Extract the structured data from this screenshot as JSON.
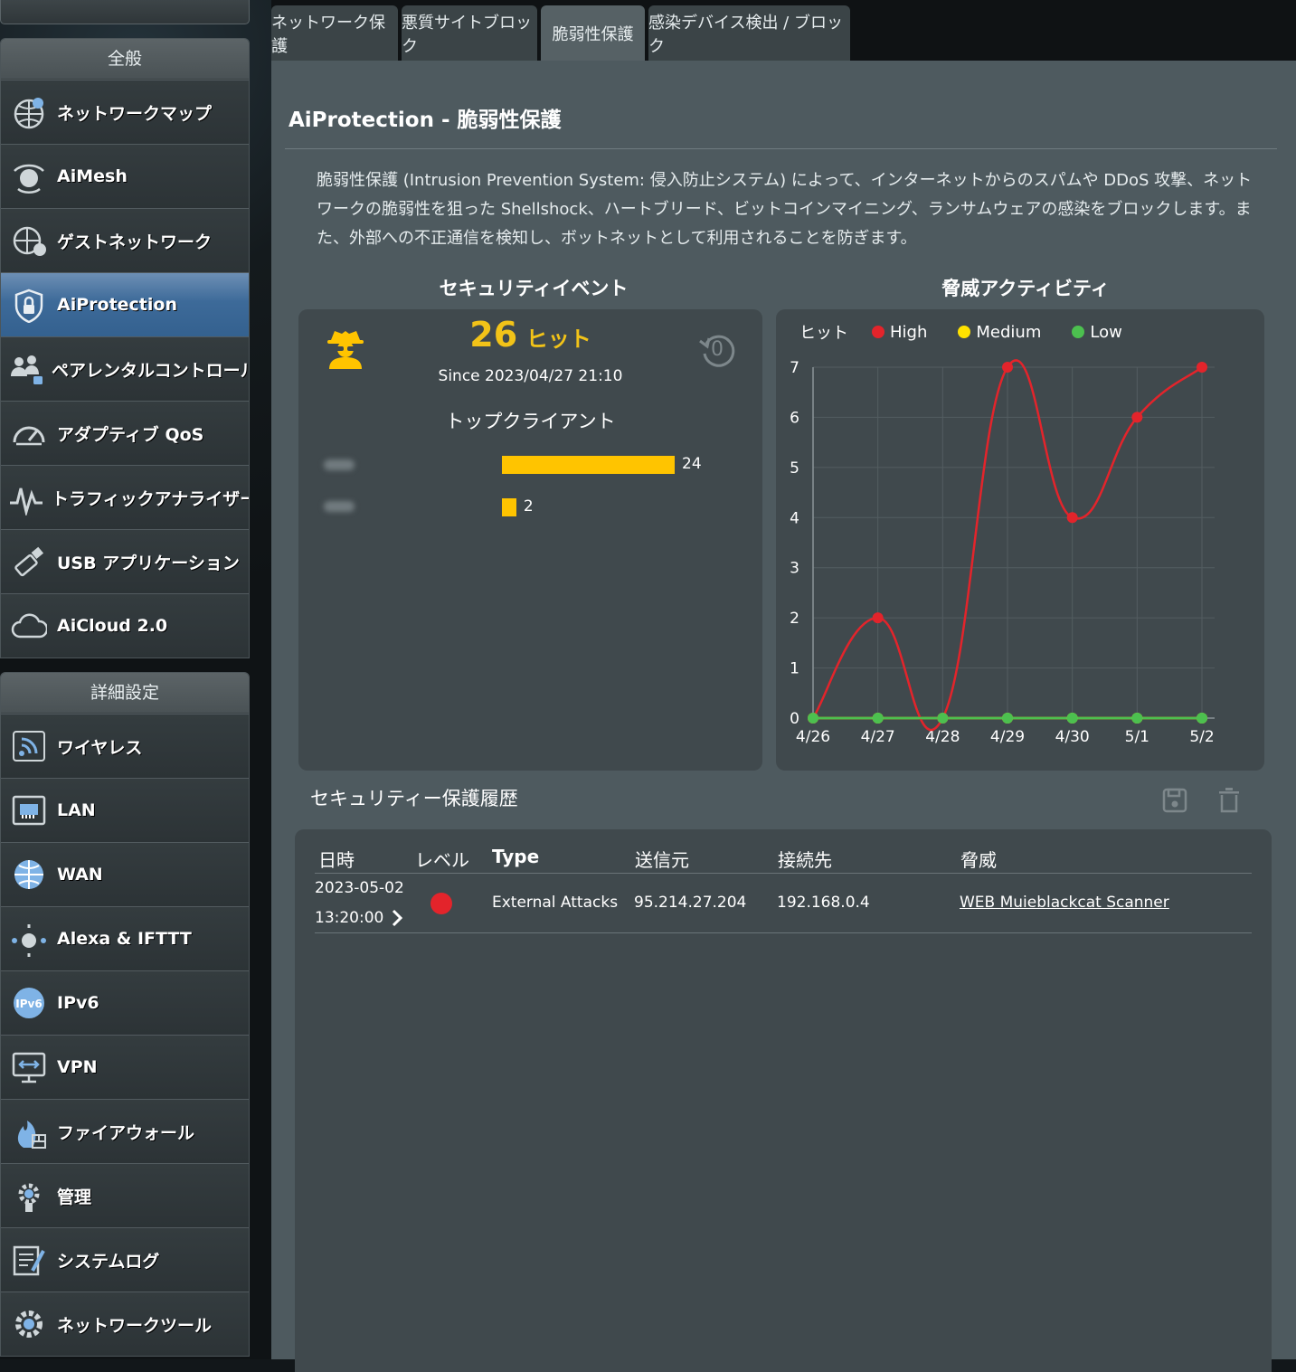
{
  "sidebar": {
    "groups": [
      {
        "heading": "全般",
        "items": [
          {
            "label": "ネットワークマップ",
            "icon": "network-map-icon"
          },
          {
            "label": "AiMesh",
            "icon": "aimesh-icon"
          },
          {
            "label": "ゲストネットワーク",
            "icon": "guest-network-icon"
          },
          {
            "label": "AiProtection",
            "icon": "shield-lock-icon",
            "active": true
          },
          {
            "label": "ペアレンタルコントロール",
            "icon": "parental-control-icon"
          },
          {
            "label": "アダプティブ QoS",
            "icon": "speedometer-icon"
          },
          {
            "label": "トラフィックアナライザー",
            "icon": "traffic-analyzer-icon"
          },
          {
            "label": "USB アプリケーション",
            "icon": "usb-icon"
          },
          {
            "label": "AiCloud 2.0",
            "icon": "cloud-icon"
          }
        ]
      },
      {
        "heading": "詳細設定",
        "items": [
          {
            "label": "ワイヤレス",
            "icon": "wireless-icon"
          },
          {
            "label": "LAN",
            "icon": "lan-icon"
          },
          {
            "label": "WAN",
            "icon": "globe-icon"
          },
          {
            "label": "Alexa & IFTTT",
            "icon": "alexa-icon"
          },
          {
            "label": "IPv6",
            "icon": "ipv6-icon"
          },
          {
            "label": "VPN",
            "icon": "vpn-icon"
          },
          {
            "label": "ファイアウォール",
            "icon": "firewall-icon"
          },
          {
            "label": "管理",
            "icon": "admin-gear-icon"
          },
          {
            "label": "システムログ",
            "icon": "system-log-icon"
          },
          {
            "label": "ネットワークツール",
            "icon": "network-tools-icon"
          }
        ]
      }
    ]
  },
  "tabs": [
    {
      "label": "ネットワーク保護"
    },
    {
      "label": "悪質サイトブロック"
    },
    {
      "label": "脆弱性保護",
      "active": true
    },
    {
      "label": "感染デバイス検出 / ブロック"
    }
  ],
  "page": {
    "title": "AiProtection - 脆弱性保護",
    "description": "脆弱性保護 (Intrusion Prevention System: 侵入防止システム) によって、インターネットからのスパムや DDoS 攻撃、ネットワークの脆弱性を狙った Shellshock、ハートブリード、ビットコインマイニング、ランサムウェアの感染をブロックします。また、外部への不正通信を検知し、ボットネットとして利用されることを防ぎます。"
  },
  "events": {
    "heading": "セキュリティイベント",
    "count": "26",
    "unit": "ヒット",
    "since": "Since 2023/04/27 21:10",
    "reset_count": "0",
    "top_clients_heading": "トップクライアント",
    "clients": [
      {
        "value": 24,
        "label": "24"
      },
      {
        "value": 2,
        "label": "2"
      }
    ],
    "colors": {
      "accent": "#f2c318",
      "bar": "#ffc400"
    }
  },
  "threat": {
    "heading": "脅威アクティビティ",
    "y_unit": "ヒット",
    "legend": [
      {
        "name": "High",
        "color": "#e3242b"
      },
      {
        "name": "Medium",
        "color": "#ffe200"
      },
      {
        "name": "Low",
        "color": "#4cc04f"
      }
    ]
  },
  "chart_data": {
    "type": "line",
    "categories": [
      "4/26",
      "4/27",
      "4/28",
      "4/29",
      "4/30",
      "5/1",
      "5/2"
    ],
    "series": [
      {
        "name": "High",
        "color": "#e3242b",
        "values": [
          0,
          2,
          0,
          7,
          4,
          6,
          7
        ]
      },
      {
        "name": "Medium",
        "color": "#ffe200",
        "values": [
          0,
          0,
          0,
          0,
          0,
          0,
          0
        ]
      },
      {
        "name": "Low",
        "color": "#4cc04f",
        "values": [
          0,
          0,
          0,
          0,
          0,
          0,
          0
        ]
      }
    ],
    "ylabel": "ヒット",
    "ylim": [
      0,
      7
    ],
    "yticks": [
      "0",
      "1",
      "2",
      "3",
      "4",
      "5",
      "6",
      "7"
    ],
    "grid": true,
    "legend": "top"
  },
  "history": {
    "title": "セキュリティー保護履歴",
    "save_icon": "save-icon",
    "delete_icon": "trash-icon",
    "columns": [
      "日時",
      "レベル",
      "Type",
      "送信元",
      "接続先",
      "脅威"
    ],
    "rows": [
      {
        "date": "2023-05-02",
        "time": "13:20:00",
        "level_color": "#e3242b",
        "type": "External Attacks",
        "source": "95.214.27.204",
        "destination": "192.168.0.4",
        "threat": "WEB Muieblackcat Scanner"
      }
    ]
  }
}
